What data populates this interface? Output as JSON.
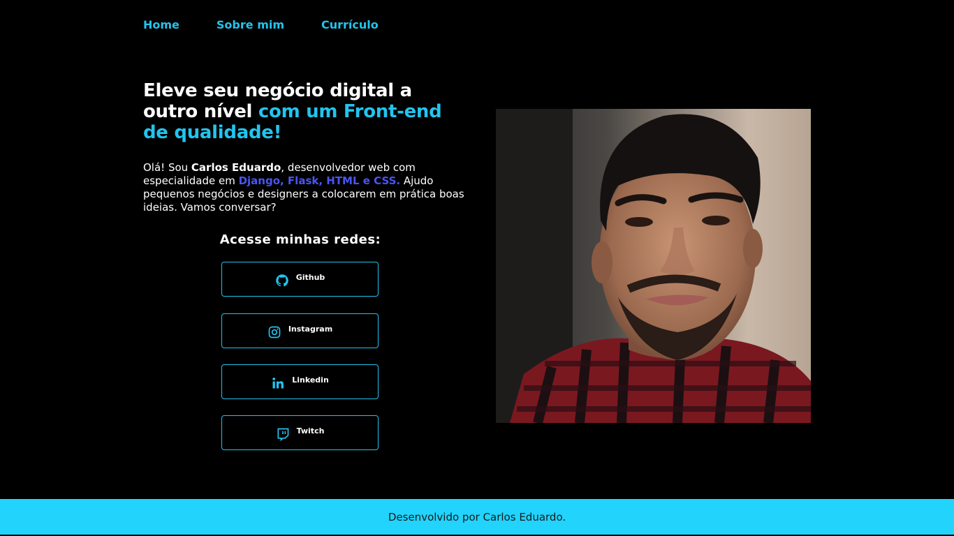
{
  "nav": {
    "items": [
      {
        "label": "Home"
      },
      {
        "label": "Sobre mim"
      },
      {
        "label": "Currículo"
      }
    ]
  },
  "hero": {
    "title_part1": "Eleve seu negócio digital a outro nível ",
    "title_accent": "com um Front-end de qualidade!"
  },
  "intro": {
    "part1": "Olá! Sou ",
    "name": "Carlos Eduardo",
    "part2": ", desenvolvedor web com especialidade em ",
    "skills": "Django, Flask, HTML e CSS.",
    "part3": " Ajudo pequenos negócios e designers a colocarem em prática boas ideias. Vamos conversar?"
  },
  "networks": {
    "heading": "Acesse minhas redes:",
    "items": [
      {
        "label": "Github",
        "icon": "github-icon"
      },
      {
        "label": "Instagram",
        "icon": "instagram-icon"
      },
      {
        "label": "Linkedin",
        "icon": "linkedin-icon"
      },
      {
        "label": "Twitch",
        "icon": "twitch-icon"
      }
    ]
  },
  "footer": {
    "text": "Desenvolvido por Carlos Eduardo."
  },
  "colors": {
    "accent": "#22c4ee",
    "skills": "#4a55f5",
    "footer_bg": "#22d3fc",
    "background": "#000000"
  }
}
